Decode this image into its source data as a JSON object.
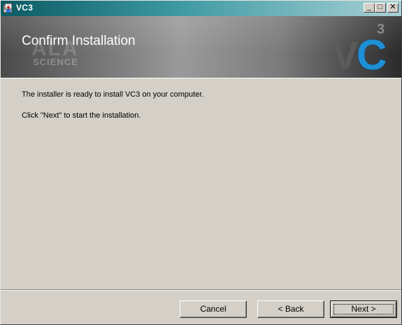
{
  "window": {
    "title": "VC3",
    "icon": "installer-icon",
    "controls": {
      "minimize": "_",
      "maximize": "□",
      "close": "✕"
    }
  },
  "banner": {
    "title": "Confirm Installation",
    "watermark_ala": "ALA",
    "watermark_science": "SCIENCE",
    "logo": {
      "v": "V",
      "c": "C",
      "superscript": "3"
    }
  },
  "content": {
    "line1": "The installer is ready to install VC3 on your computer.",
    "line2": "Click \"Next\" to start the installation."
  },
  "buttons": {
    "cancel": "Cancel",
    "back": "< Back",
    "next": "Next >"
  },
  "colors": {
    "titlebar_start": "#0a5a63",
    "titlebar_end": "#a8d0d6",
    "dialog_face": "#d4d0c8",
    "logo_accent": "#1e90d6"
  }
}
